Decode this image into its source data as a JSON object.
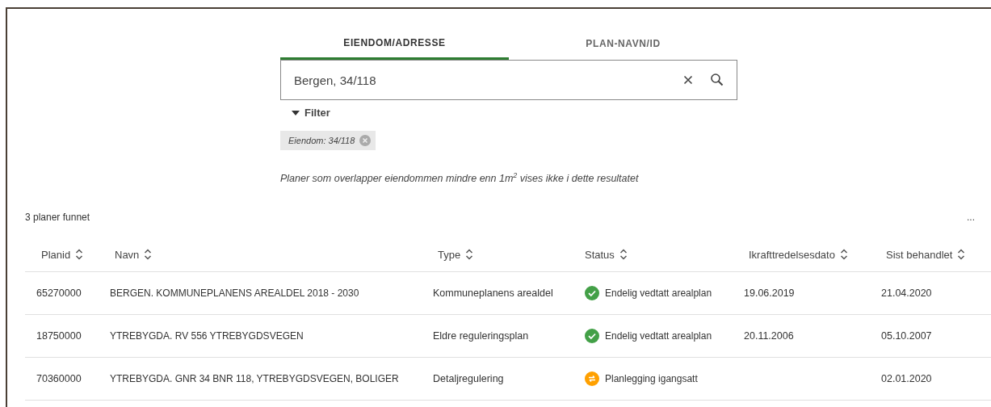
{
  "tabs": [
    {
      "label": "EIENDOM/ADRESSE",
      "selected": true
    },
    {
      "label": "PLAN-NAVN/ID",
      "selected": false
    }
  ],
  "search": {
    "value": "Bergen, 34/118"
  },
  "filter": {
    "label": "Filter",
    "expanded": true
  },
  "chips": [
    {
      "label": "Eiendom: 34/118"
    }
  ],
  "note": "Planer som overlapper eiendommen mindre enn 1m$^{2}$ vises ikke i dette resultatet",
  "result_count": "3 planer funnet",
  "more": "...",
  "table": {
    "columns": [
      "Planid",
      "Navn",
      "Type",
      "Status",
      "Ikrafttredelsesdato",
      "Sist behandlet"
    ],
    "rows": [
      {
        "planid": "65270000",
        "navn": "BERGEN. KOMMUNEPLANENS AREALDEL 2018 - 2030",
        "type": "Kommuneplanens arealdel",
        "status": {
          "kind": "done",
          "label": "Endelig vedtatt arealplan",
          "color": "#43a047"
        },
        "ikraft": "19.06.2019",
        "sist": "21.04.2020"
      },
      {
        "planid": "18750000",
        "navn": "YTREBYGDA. RV 556 YTREBYGDSVEGEN",
        "type": "Eldre reguleringsplan",
        "status": {
          "kind": "done",
          "label": "Endelig vedtatt arealplan",
          "color": "#43a047"
        },
        "ikraft": "20.11.2006",
        "sist": "05.10.2007"
      },
      {
        "planid": "70360000",
        "navn": "YTREBYGDA. GNR 34 BNR 118, YTREBYGDSVEGEN, BOLIGER",
        "type": "Detaljregulering",
        "status": {
          "kind": "progress",
          "label": "Planlegging igangsatt",
          "color": "#ffa000"
        },
        "sist": "02.01.2020"
      }
    ]
  }
}
